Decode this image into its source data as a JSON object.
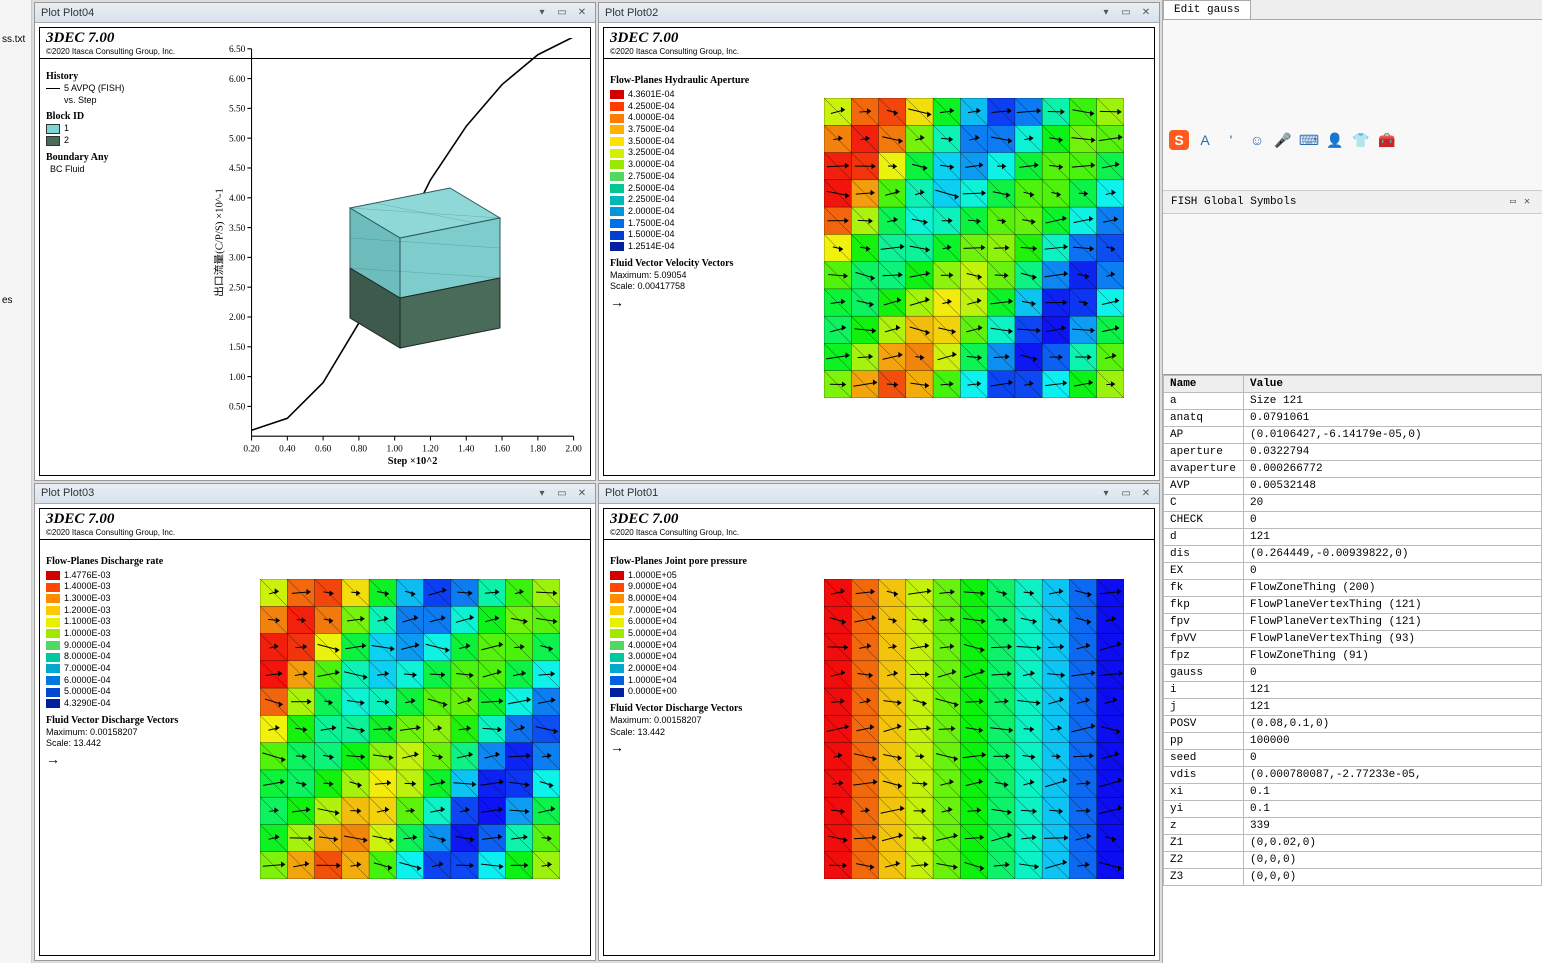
{
  "left_gutter": {
    "item1": "ss.txt",
    "item2": "es"
  },
  "plots": {
    "p04": {
      "title": "Plot Plot04",
      "brand": "3DEC 7.00",
      "copyright": "©2020 Itasca Consulting Group, Inc.",
      "history_label": "History",
      "history_item": "5 AVPQ (FISH)",
      "vs_step": "vs. Step",
      "block_id_label": "Block ID",
      "block_ids": [
        "1",
        "2"
      ],
      "boundary_label": "Boundary Any",
      "boundary_item": "BC Fluid",
      "xlabel": "Step ×10^2",
      "ylabel": "出口流量(C/P/S) 1-01×"
    },
    "p02": {
      "title": "Plot Plot02",
      "brand": "3DEC 7.00",
      "copyright": "©2020 Itasca Consulting Group, Inc.",
      "legend_title": "Flow-Planes Hydraulic Aperture",
      "vec_title": "Fluid Vector Velocity Vectors",
      "vec_max": "Maximum: 5.09054",
      "vec_scale": "Scale: 0.00417758"
    },
    "p03": {
      "title": "Plot Plot03",
      "brand": "3DEC 7.00",
      "copyright": "©2020 Itasca Consulting Group, Inc.",
      "legend_title": "Flow-Planes Discharge rate",
      "vec_title": "Fluid Vector Discharge Vectors",
      "vec_max": "Maximum: 0.00158207",
      "vec_scale": "Scale: 13.442"
    },
    "p01": {
      "title": "Plot Plot01",
      "brand": "3DEC 7.00",
      "copyright": "©2020 Itasca Consulting Group, Inc.",
      "legend_title": "Flow-Planes Joint pore pressure",
      "vec_title": "Fluid Vector Discharge Vectors",
      "vec_max": "Maximum: 0.00158207",
      "vec_scale": "Scale: 13.442"
    }
  },
  "right": {
    "tab": "Edit gauss",
    "fish_header": "FISH Global Symbols",
    "table_headers": {
      "name": "Name",
      "value": "Value"
    },
    "symbols": [
      {
        "name": "a",
        "value": "Size 121"
      },
      {
        "name": "anatq",
        "value": "0.0791061"
      },
      {
        "name": "AP",
        "value": "(0.0106427,-6.14179e-05,0)"
      },
      {
        "name": "aperture",
        "value": "0.0322794"
      },
      {
        "name": "avaperture",
        "value": "0.000266772"
      },
      {
        "name": "AVP",
        "value": "0.00532148"
      },
      {
        "name": "C",
        "value": "20"
      },
      {
        "name": "CHECK",
        "value": "0"
      },
      {
        "name": "d",
        "value": "121"
      },
      {
        "name": "dis",
        "value": "(0.264449,-0.00939822,0)"
      },
      {
        "name": "EX",
        "value": "0"
      },
      {
        "name": "fk",
        "value": "FlowZoneThing (200)"
      },
      {
        "name": "fkp",
        "value": "FlowPlaneVertexThing (121)"
      },
      {
        "name": "fpv",
        "value": "FlowPlaneVertexThing (121)"
      },
      {
        "name": "fpVV",
        "value": "FlowPlaneVertexThing (93)"
      },
      {
        "name": "fpz",
        "value": "FlowZoneThing (91)"
      },
      {
        "name": "gauss",
        "value": "0"
      },
      {
        "name": "i",
        "value": "121"
      },
      {
        "name": "j",
        "value": "121"
      },
      {
        "name": "POSV",
        "value": "(0.08,0.1,0)"
      },
      {
        "name": "pp",
        "value": "100000"
      },
      {
        "name": "seed",
        "value": "0"
      },
      {
        "name": "vdis",
        "value": "(0.000780087,-2.77233e-05,"
      },
      {
        "name": "xi",
        "value": "0.1"
      },
      {
        "name": "yi",
        "value": "0.1"
      },
      {
        "name": "z",
        "value": "339"
      },
      {
        "name": "Z1",
        "value": "(0,0.02,0)"
      },
      {
        "name": "Z2",
        "value": "(0,0,0)"
      },
      {
        "name": "Z3",
        "value": "(0,0,0)"
      }
    ]
  },
  "chart_data": [
    {
      "id": "plot04",
      "type": "line",
      "title": "History 5 AVPQ (FISH) vs. Step",
      "xlabel": "Step ×10^2",
      "ylabel": "出口流量(C/P/S) ×10^-1",
      "x_ticks": [
        0.2,
        0.4,
        0.6,
        0.8,
        1.0,
        1.2,
        1.4,
        1.6,
        1.8,
        2.0
      ],
      "y_ticks": [
        0.5,
        1.0,
        1.5,
        2.0,
        2.5,
        3.0,
        3.5,
        4.0,
        4.5,
        5.0,
        5.5,
        6.0,
        6.5
      ],
      "series": [
        {
          "name": "5 AVPQ (FISH)",
          "x": [
            0.2,
            0.4,
            0.6,
            0.8,
            1.0,
            1.2,
            1.4,
            1.6,
            1.8,
            2.0
          ],
          "y": [
            0.1,
            0.3,
            0.9,
            1.9,
            3.1,
            4.3,
            5.2,
            5.9,
            6.4,
            6.7
          ]
        }
      ]
    },
    {
      "id": "plot02",
      "type": "heatmap",
      "title": "Flow-Planes Hydraulic Aperture",
      "colorbar_labels": [
        "4.3601E-04",
        "4.2500E-04",
        "4.0000E-04",
        "3.7500E-04",
        "3.5000E-04",
        "3.2500E-04",
        "3.0000E-04",
        "2.7500E-04",
        "2.5000E-04",
        "2.2500E-04",
        "2.0000E-04",
        "1.7500E-04",
        "1.5000E-04",
        "1.2514E-04"
      ],
      "colorbar_colors": [
        "#d40000",
        "#ff3b00",
        "#ff7a00",
        "#ffb000",
        "#ffe000",
        "#d4f000",
        "#98e800",
        "#50d860",
        "#00c890",
        "#00b8b8",
        "#0098d8",
        "#0070e8",
        "#0040d0",
        "#0020a0"
      ],
      "vector_overlay": {
        "type": "Fluid Vector Velocity Vectors",
        "maximum": 5.09054,
        "scale": 0.00417758
      }
    },
    {
      "id": "plot03",
      "type": "heatmap",
      "title": "Flow-Planes Discharge rate",
      "colorbar_labels": [
        "1.4776E-03",
        "1.4000E-03",
        "1.3000E-03",
        "1.2000E-03",
        "1.1000E-03",
        "1.0000E-03",
        "9.0000E-04",
        "8.0000E-04",
        "7.0000E-04",
        "6.0000E-04",
        "5.0000E-04",
        "4.3290E-04"
      ],
      "colorbar_colors": [
        "#d40000",
        "#ff4800",
        "#ff8c00",
        "#ffc800",
        "#e8f000",
        "#a0e800",
        "#50d860",
        "#00c8a0",
        "#00a8d0",
        "#0078e0",
        "#0048d0",
        "#0020a0"
      ],
      "vector_overlay": {
        "type": "Fluid Vector Discharge Vectors",
        "maximum": 0.00158207,
        "scale": 13.442
      }
    },
    {
      "id": "plot01",
      "type": "heatmap",
      "title": "Flow-Planes Joint pore pressure",
      "colorbar_labels": [
        "1.0000E+05",
        "9.0000E+04",
        "8.0000E+04",
        "7.0000E+04",
        "6.0000E+04",
        "5.0000E+04",
        "4.0000E+04",
        "3.0000E+04",
        "2.0000E+04",
        "1.0000E+04",
        "0.0000E+00"
      ],
      "colorbar_colors": [
        "#d40000",
        "#ff4800",
        "#ff8c00",
        "#ffc800",
        "#e8f000",
        "#a0e800",
        "#50d860",
        "#00c8a0",
        "#00a8d0",
        "#0060e0",
        "#0020a0"
      ],
      "vector_overlay": {
        "type": "Fluid Vector Discharge Vectors",
        "maximum": 0.00158207,
        "scale": 13.442
      }
    }
  ]
}
